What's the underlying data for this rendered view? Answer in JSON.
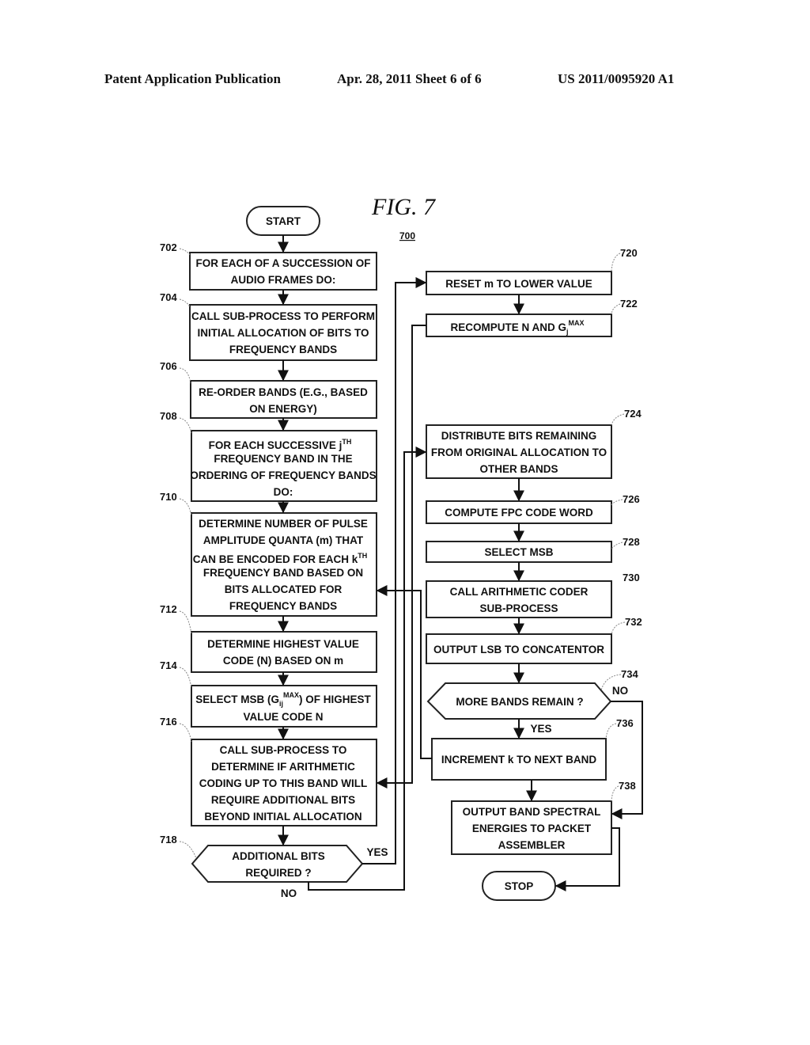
{
  "header": {
    "publication": "Patent Application Publication",
    "date_sheet": "Apr. 28, 2011  Sheet 6 of 6",
    "number": "US 2011/0095920 A1"
  },
  "figure": {
    "title": "FIG. 7",
    "ref": "700"
  },
  "terminals": {
    "start": "START",
    "stop": "STOP"
  },
  "steps": {
    "s702": {
      "ref": "702",
      "lines": [
        "FOR EACH OF A SUCCESSION OF",
        "AUDIO FRAMES DO:"
      ]
    },
    "s704": {
      "ref": "704",
      "lines": [
        "CALL SUB-PROCESS TO PERFORM",
        "INITIAL ALLOCATION OF BITS TO",
        "FREQUENCY BANDS"
      ]
    },
    "s706": {
      "ref": "706",
      "lines": [
        "RE-ORDER BANDS (E.G., BASED",
        "ON ENERGY)"
      ]
    },
    "s708": {
      "ref": "708",
      "line1": "FOR EACH SUCCESSIVE j",
      "line1_sup": "TH",
      "lines": [
        "FREQUENCY BAND IN THE",
        "ORDERING OF FREQUENCY BANDS",
        "DO:"
      ]
    },
    "s710": {
      "ref": "710",
      "lines_a": [
        "DETERMINE NUMBER OF PULSE",
        "AMPLITUDE QUANTA (m) THAT"
      ],
      "line3": "CAN BE ENCODED FOR EACH k",
      "line3_sup": "TH",
      "lines_b": [
        "FREQUENCY BAND BASED ON",
        "BITS ALLOCATED FOR",
        "FREQUENCY BANDS"
      ]
    },
    "s712": {
      "ref": "712",
      "lines": [
        "DETERMINE HIGHEST VALUE",
        "CODE (N) BASED ON m"
      ]
    },
    "s714": {
      "ref": "714",
      "pre": "SELECT MSB (G",
      "sub": "ij",
      "sup": "MAX",
      "post": ") OF HIGHEST",
      "line2": "VALUE CODE N"
    },
    "s716": {
      "ref": "716",
      "lines": [
        "CALL SUB-PROCESS TO",
        "DETERMINE IF ARITHMETIC",
        "CODING UP TO THIS BAND WILL",
        "REQUIRE ADDITIONAL BITS",
        "BEYOND INITIAL ALLOCATION"
      ]
    },
    "s718": {
      "ref": "718",
      "lines": [
        "ADDITIONAL BITS",
        "REQUIRED ?"
      ],
      "yes": "YES",
      "no": "NO"
    },
    "s720": {
      "ref": "720",
      "lines": [
        "RESET m TO LOWER VALUE"
      ]
    },
    "s722": {
      "ref": "722",
      "pre": "RECOMPUTE N AND G",
      "sub": "j",
      "sup": "MAX"
    },
    "s724": {
      "ref": "724",
      "lines": [
        "DISTRIBUTE BITS REMAINING",
        "FROM ORIGINAL ALLOCATION TO",
        "OTHER BANDS"
      ]
    },
    "s726": {
      "ref": "726",
      "lines": [
        "COMPUTE FPC CODE WORD"
      ]
    },
    "s728": {
      "ref": "728",
      "lines": [
        "SELECT MSB"
      ]
    },
    "s730": {
      "ref": "730",
      "lines": [
        "CALL ARITHMETIC CODER",
        "SUB-PROCESS"
      ]
    },
    "s732": {
      "ref": "732",
      "lines": [
        "OUTPUT LSB TO CONCATENTOR"
      ]
    },
    "s734": {
      "ref": "734",
      "lines": [
        "MORE BANDS REMAIN ?"
      ],
      "yes": "YES",
      "no": "NO"
    },
    "s736": {
      "ref": "736",
      "lines": [
        "INCREMENT k TO NEXT BAND"
      ]
    },
    "s738": {
      "ref": "738",
      "lines": [
        "OUTPUT BAND SPECTRAL",
        "ENERGIES  TO PACKET",
        "ASSEMBLER"
      ]
    }
  }
}
